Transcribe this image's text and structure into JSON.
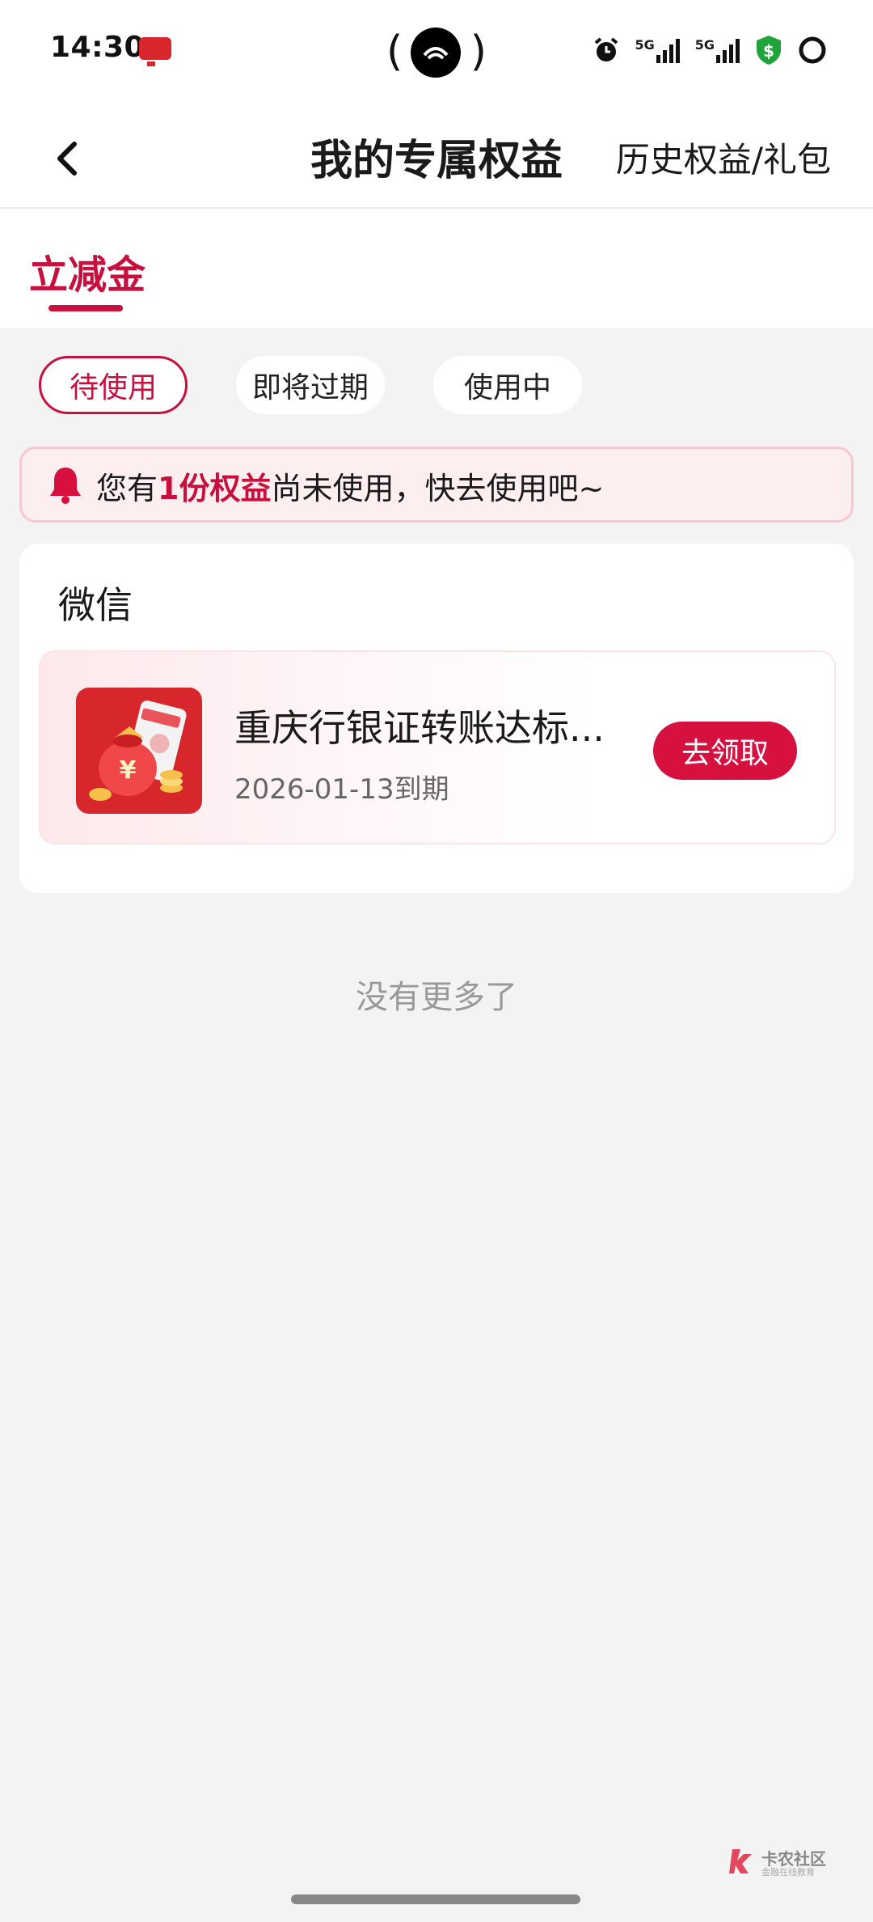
{
  "status_bar": {
    "time": "14:30",
    "network_1": "5G",
    "network_2": "5G",
    "icons": [
      "notification-app-icon",
      "alarm-icon",
      "signal-icon",
      "signal-icon",
      "shield-dollar-icon",
      "ring-icon"
    ]
  },
  "nav": {
    "title": "我的专属权益",
    "history_label": "历史权益/礼包"
  },
  "tabs": [
    {
      "label": "立减金",
      "active": true
    }
  ],
  "filters": [
    {
      "label": "待使用",
      "active": true
    },
    {
      "label": "即将过期",
      "active": false
    },
    {
      "label": "使用中",
      "active": false
    }
  ],
  "notice": {
    "prefix": "您有",
    "highlight": "1份权益",
    "suffix": "尚未使用，快去使用吧~"
  },
  "sections": [
    {
      "title": "微信",
      "items": [
        {
          "name": "重庆行银证转账达标...",
          "expiry": "2026-01-13到期",
          "action": "去领取"
        }
      ]
    }
  ],
  "footer": {
    "no_more": "没有更多了"
  },
  "watermark": {
    "title": "卡农社区",
    "subtitle": "金融在线教育"
  },
  "colors": {
    "accent": "#c8103e",
    "button": "#d6103f",
    "notice_bg": "#fdeef0",
    "page_bg": "#f3f3f3"
  }
}
